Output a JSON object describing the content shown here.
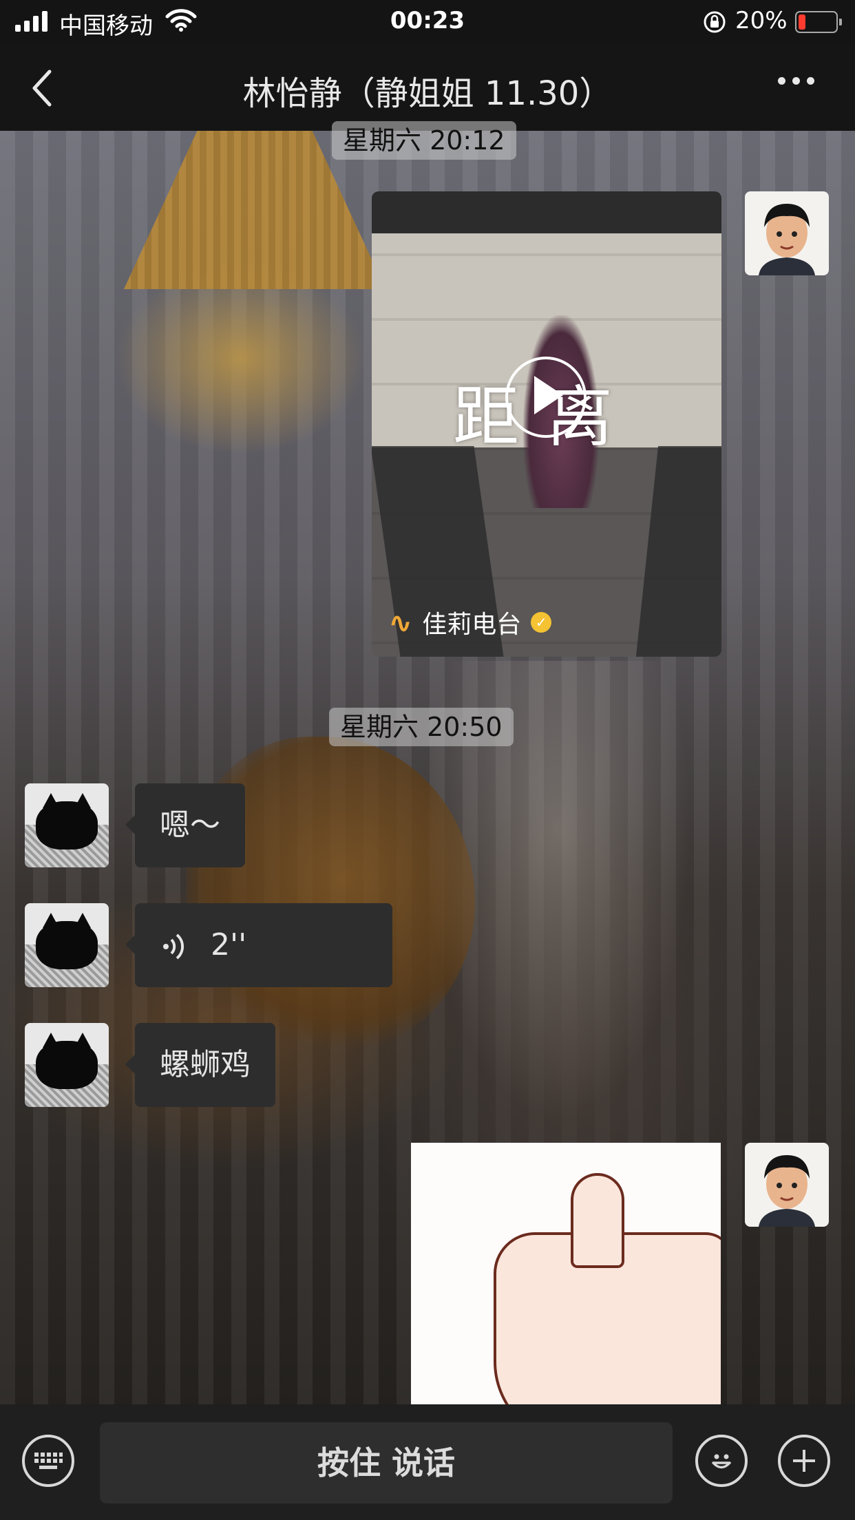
{
  "status_bar": {
    "carrier": "中国移动",
    "time": "00:23",
    "battery_percent": "20%",
    "battery_level": 0.2,
    "icons": [
      "signal-icon",
      "wifi-icon",
      "orientation-lock-icon",
      "battery-icon"
    ]
  },
  "nav": {
    "title": "林怡静（静姐姐 11.30）",
    "icons": [
      "back-icon",
      "more-icon"
    ]
  },
  "messages": {
    "timestamp_1": "星期六 20:12",
    "video": {
      "title": "距离",
      "channel": "佳莉电台",
      "icons": [
        "play-icon",
        "channel-logo-icon",
        "verified-icon"
      ]
    },
    "timestamp_2": "星期六 20:50",
    "text_1": "嗯～",
    "voice_duration": "2''",
    "text_2": "螺蛳鸡"
  },
  "input_bar": {
    "hold_to_talk": "按住 说话",
    "icons": [
      "keyboard-icon",
      "emoji-icon",
      "plus-icon"
    ]
  },
  "colors": {
    "bar_background": "#151515",
    "bubble": "#2d2d2d",
    "battery_low": "#ff3b30",
    "verified": "#f4c232"
  }
}
